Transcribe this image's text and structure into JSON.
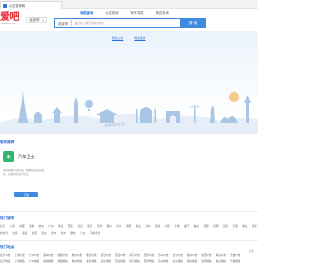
{
  "browser": {
    "tab_title": "公交查询网"
  },
  "header": {
    "logo_main": "爱吧",
    "logo_sub": "www.aibus.com",
    "city": "北京市"
  },
  "search": {
    "tabs": [
      "地图查询",
      "公交查询",
      "驾车导航",
      "周边查询"
    ],
    "active_tab": 0,
    "city": "北京市",
    "placeholder": "输入要查询的地址",
    "button": "搜 索",
    "links": [
      "附近公交",
      "附近美食"
    ]
  },
  "hero": {
    "slogan": "快捷导航生活"
  },
  "apps_section": {
    "title": "软件推荐",
    "app_name": "汽车卫士",
    "app_desc": "为您收集车站信息，查看附近的交通工具，方便您的出行生活。",
    "download": "下载"
  },
  "cities_section": {
    "title": "热门城市",
    "row1": [
      "北京",
      "上海",
      "成都",
      "深圳",
      "杭州",
      "广州",
      "重庆",
      "西安",
      "武汉",
      "南京",
      "天津",
      "郑州",
      "长沙",
      "沈阳",
      "青岛",
      "苏州",
      "济南",
      "大连",
      "宁波",
      "厦门",
      "福州",
      "合肥",
      "昆明",
      "东莞",
      "无锡",
      "佛山",
      "南宁",
      "贵阳",
      "石家庄"
    ],
    "row2": [
      "哈尔滨",
      "长春",
      "南昌",
      "太原",
      "温州",
      "常州",
      "泉州",
      "烟台",
      "兰州",
      "乌鲁木齐"
    ]
  },
  "poi_section": {
    "title": "热门地点",
    "more": "更多",
    "row1": [
      "北京公交",
      "上海公交",
      "广州公交",
      "深圳公交",
      "成都公交",
      "杭州公交",
      "重庆公交",
      "武汉公交",
      "西安公交",
      "南京公交",
      "天津公交",
      "苏州公交",
      "长沙公交",
      "郑州公交",
      "沈阳公交",
      "青岛公交",
      "宁波公交"
    ],
    "row2": [
      "北京地铁",
      "上海地铁",
      "广州地铁",
      "深圳地铁",
      "成都地铁",
      "杭州地铁",
      "重庆地铁",
      "武汉地铁",
      "西安地铁",
      "南京地铁",
      "天津地铁",
      "苏州地铁",
      "长沙地铁",
      "郑州地铁",
      "沈阳地铁",
      "青岛地铁",
      "宁波地铁"
    ]
  },
  "colors": {
    "brand_red": "#e4262c",
    "accent_blue": "#3f8ae0",
    "app_green": "#2fb66a"
  }
}
